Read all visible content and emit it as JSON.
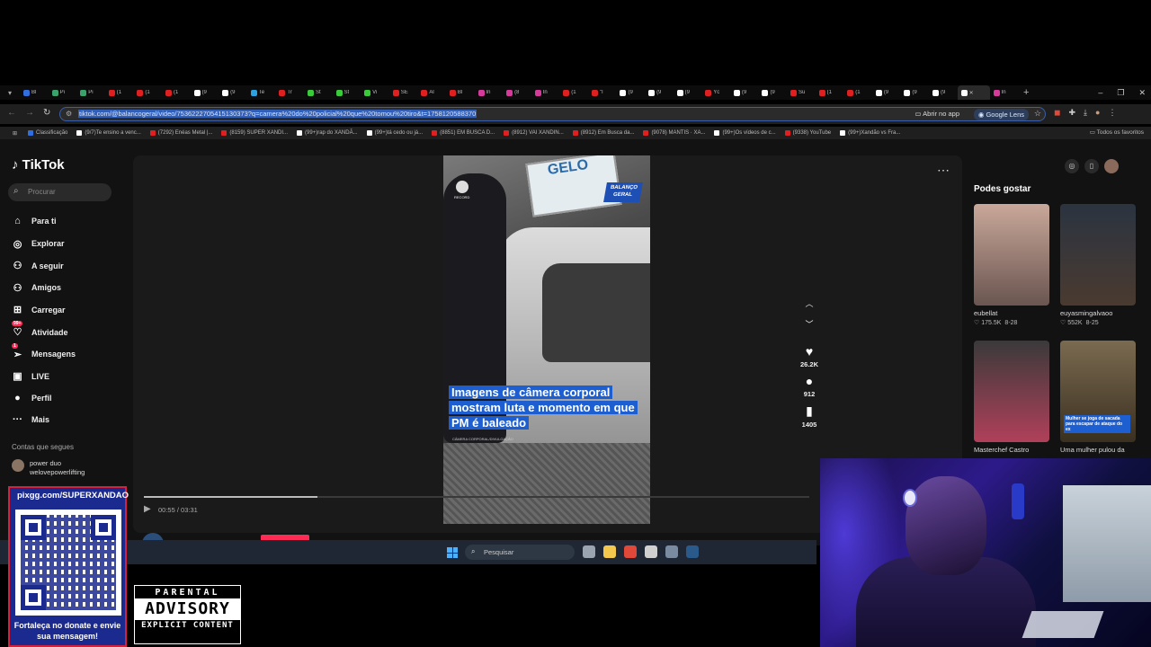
{
  "browser": {
    "tabs": [
      {
        "label": "Bl",
        "color": "#2f6fe0"
      },
      {
        "label": "Pi",
        "color": "#3aa36b"
      },
      {
        "label": "Pi",
        "color": "#3aa36b"
      },
      {
        "label": "(1",
        "color": "#e02020"
      },
      {
        "label": "(1",
        "color": "#e02020"
      },
      {
        "label": "(1",
        "color": "#e02020"
      },
      {
        "label": "(9",
        "color": "#ffffff"
      },
      {
        "label": "(9",
        "color": "#ffffff"
      },
      {
        "label": "Te",
        "color": "#2aa3e0"
      },
      {
        "label": "Tr",
        "color": "#e02020"
      },
      {
        "label": "St",
        "color": "#3acb3a"
      },
      {
        "label": "St",
        "color": "#3acb3a"
      },
      {
        "label": "Vi",
        "color": "#3acb3a"
      },
      {
        "label": "SE",
        "color": "#e02020"
      },
      {
        "label": "Al",
        "color": "#e02020"
      },
      {
        "label": "Bl",
        "color": "#e02020"
      },
      {
        "label": "In",
        "color": "#d63a9a"
      },
      {
        "label": "(8",
        "color": "#d63a9a"
      },
      {
        "label": "In",
        "color": "#d63a9a"
      },
      {
        "label": "(1",
        "color": "#e02020"
      },
      {
        "label": "\"I",
        "color": "#e02020"
      },
      {
        "label": "(9",
        "color": "#ffffff"
      },
      {
        "label": "(9",
        "color": "#ffffff"
      },
      {
        "label": "(9",
        "color": "#ffffff"
      },
      {
        "label": "Yc",
        "color": "#e02020"
      },
      {
        "label": "(9",
        "color": "#ffffff"
      },
      {
        "label": "(9",
        "color": "#ffffff"
      },
      {
        "label": "Su",
        "color": "#e02020"
      },
      {
        "label": "(1",
        "color": "#e02020"
      },
      {
        "label": "(1",
        "color": "#e02020"
      },
      {
        "label": "(9",
        "color": "#ffffff"
      },
      {
        "label": "(9",
        "color": "#ffffff"
      },
      {
        "label": "(9",
        "color": "#ffffff"
      },
      {
        "label": "✕",
        "color": "#ffffff",
        "active": true
      },
      {
        "label": "In",
        "color": "#d63a9a"
      }
    ],
    "new_tab": "+",
    "window_controls": [
      "–",
      "❐",
      "✕"
    ],
    "url": "tiktok.com/@balancogeral/video/7536222705415130373?q=camera%20do%20policial%20que%20tomou%20tiro&t=1758120588370",
    "open_in_app": "Abrir no app",
    "google_lens": "Google Lens",
    "bookmarks": [
      {
        "label": "Classificação",
        "color": "#2f6fe0"
      },
      {
        "label": "(9/7)Te ensino a venc...",
        "color": "#ffffff"
      },
      {
        "label": "(7292) Enéas Metal |...",
        "color": "#e02020"
      },
      {
        "label": "(8159) SUPER XANDI...",
        "color": "#e02020"
      },
      {
        "label": "(99+)rap do XANDÃ...",
        "color": "#ffffff"
      },
      {
        "label": "(99+)tá cedo ou já...",
        "color": "#ffffff"
      },
      {
        "label": "(8851) EM BUSCA D...",
        "color": "#e02020"
      },
      {
        "label": "(8912) VAI XANDIN...",
        "color": "#e02020"
      },
      {
        "label": "(8912) Em Busca da...",
        "color": "#e02020"
      },
      {
        "label": "(9078) MANTIS · XA...",
        "color": "#e02020"
      },
      {
        "label": "(99+)Os vídeos de c...",
        "color": "#ffffff"
      },
      {
        "label": "(9338) YouTube",
        "color": "#e02020"
      },
      {
        "label": "(99+)Xandão vs Fra...",
        "color": "#ffffff"
      }
    ],
    "all_favorites": "Todos os favoritos"
  },
  "tiktok": {
    "logo": "TikTok",
    "search_placeholder": "Procurar",
    "nav": [
      {
        "label": "Para ti",
        "icon": "⌂"
      },
      {
        "label": "Explorar",
        "icon": "◎"
      },
      {
        "label": "A seguir",
        "icon": "⚇"
      },
      {
        "label": "Amigos",
        "icon": "⚇"
      },
      {
        "label": "Carregar",
        "icon": "⊞"
      },
      {
        "label": "Atividade",
        "icon": "♡",
        "badge": "99+"
      },
      {
        "label": "Mensagens",
        "icon": "➢",
        "badge": "1"
      },
      {
        "label": "LIVE",
        "icon": "▣"
      },
      {
        "label": "Perfil",
        "icon": "●"
      },
      {
        "label": "Mais",
        "icon": "···"
      }
    ],
    "following_title": "Contas que segues",
    "following_user": {
      "name": "power duo",
      "handle": "welovepowerlifting"
    },
    "video": {
      "sign_text": "GELO",
      "record_label": "RECORD",
      "badge": "BALANÇO GERAL",
      "caption": "Imagens de câmera corporal mostram luta e momento em que PM é baleado",
      "caption_credit": "CÂMERA CORPORAL/DIVULGAÇÃO",
      "progress": 0.261,
      "time": "00:55 / 03:31"
    },
    "actions": {
      "likes": "26.2K",
      "comments": "912",
      "saves": "1405"
    },
    "author": "balancogeral",
    "suggest_title": "Podes gostar",
    "suggestions": [
      {
        "user": "eubellat",
        "likes": "175.5K",
        "date": "8-28",
        "thumb_top": "#c9a89a",
        "thumb_bottom": "#6a5550"
      },
      {
        "user": "euyasmingalvaoo",
        "likes": "552K",
        "date": "8-25",
        "thumb_top": "#2b3440",
        "thumb_bottom": "#4a3a30"
      },
      {
        "user": "Masterchef Castro",
        "likes": "",
        "date": "",
        "thumb_top": "#3a3a3a",
        "thumb_bottom": "#b0405a"
      },
      {
        "user": "Uma mulher pulou da",
        "likes": "",
        "date": "",
        "thumb_top": "#7a6a50",
        "thumb_bottom": "#3a3020",
        "caption": "Mulher se joga de sacada para escapar de ataque do ex"
      }
    ]
  },
  "taskbar": {
    "search_placeholder": "Pesquisar",
    "apps": [
      {
        "name": "task-view-icon",
        "color": "#9aa4b0"
      },
      {
        "name": "file-explorer-icon",
        "color": "#f2c94c"
      },
      {
        "name": "chrome-icon",
        "color": "#e0483a"
      },
      {
        "name": "snipping-tool-icon",
        "color": "#d0d0d0"
      },
      {
        "name": "settings-icon",
        "color": "#7a8aa0"
      },
      {
        "name": "steam-icon",
        "color": "#2a5a8a"
      }
    ]
  },
  "overlay": {
    "qr_url": "pixgg.com/SUPERXANDAO",
    "qr_message": "Fortaleça no donate e envie sua mensagem!",
    "advisory_line1": "PARENTAL",
    "advisory_line2": "ADVISORY",
    "advisory_line3": "EXPLICIT CONTENT"
  }
}
